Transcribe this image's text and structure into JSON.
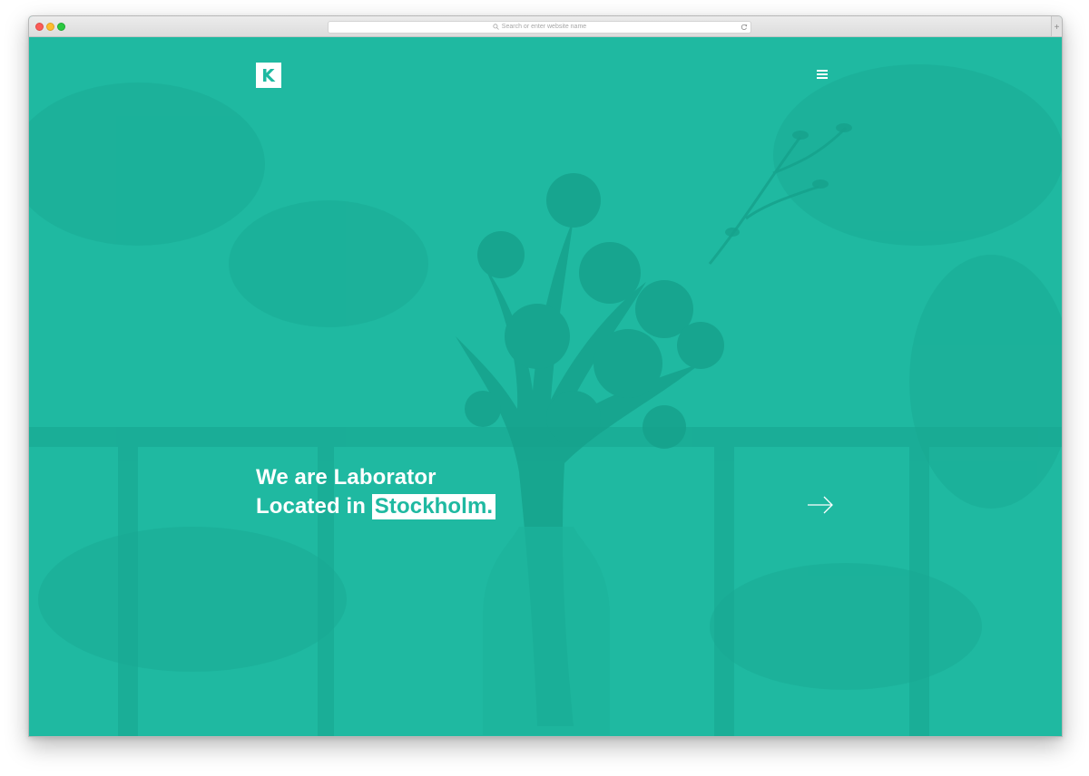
{
  "browser": {
    "address_placeholder": "Search or enter website name",
    "new_tab_label": "+"
  },
  "page": {
    "accent_color": "#1fb9a1",
    "logo": {
      "letter": "K",
      "icon": "k-logo-icon"
    },
    "menu_icon": "hamburger-menu-icon",
    "headline": {
      "line1": "We are Laborator",
      "line2_prefix": "Located in",
      "line2_highlight": "Stockholm."
    },
    "next_icon": "arrow-right-icon"
  }
}
